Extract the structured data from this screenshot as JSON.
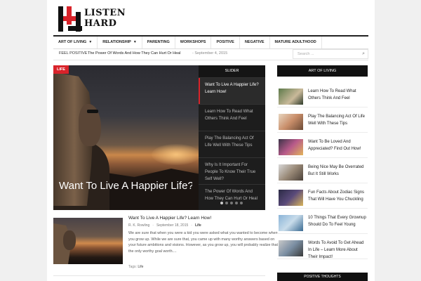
{
  "brand": {
    "line1": "LISTEN",
    "line2": "HARD",
    "accent": "#d9232a"
  },
  "nav": {
    "items": [
      {
        "label": "Art of Living",
        "has_dropdown": true
      },
      {
        "label": "Relationship",
        "has_dropdown": true
      },
      {
        "label": "Parenting",
        "has_dropdown": false
      },
      {
        "label": "Workshops",
        "has_dropdown": false
      },
      {
        "label": "Positive",
        "has_dropdown": false
      },
      {
        "label": "Negative",
        "has_dropdown": false
      },
      {
        "label": "Mature Adulthood",
        "has_dropdown": false
      }
    ],
    "chevron": "▼"
  },
  "ticker": {
    "label": "FEEL POSITIVE",
    "text": "The Power Of Words And How They Can Hurt Or Heal",
    "date": "- September 4, 2015"
  },
  "search": {
    "placeholder": "Search ...",
    "icon": "search-icon"
  },
  "slider": {
    "badge": "Life",
    "hero_title": "Want To Live A Happier Life? Learn How!",
    "header": "SLIDER",
    "items": [
      "Want To Live A Happier Life? Learn How!",
      "Learn How To Read What Others Think And Feel",
      "Play The Balancing Act Of Life Well With These Tips",
      "Why Is It Important For People To Know Their True Self Well?",
      "The Power Of Words And How They Can Hurt Or Heal"
    ],
    "active_index": 0,
    "dots": 5
  },
  "post": {
    "title": "Want To Live A Happier Life? Learn How!",
    "author": "R. K. Rowling",
    "date": "September 18, 2015",
    "category": "Life",
    "excerpt": "We are sure that when you were a kid you were asked what you wanted to become when you grow up. While we are sure that, you came up with many worthy answers based on your future ambitions and visions. However, as you grow up, you will probably realize that the only worthy goal worth....",
    "tags_label": "Tags:",
    "tags_value": "Life"
  },
  "sidebar": {
    "header": "ART OF LIVING",
    "items": [
      "Learn How To Read What Others Think And Feel",
      "Play The Balancing Act Of Life Well With These Tips",
      "Want To Be Loved And Appreciated? Find Out How!",
      "Being Nice May Be Overrated But It Still Works",
      "Fun Facts About Zodiac Signs That Will Have You Chuckling",
      "10 Things That Every Grownup Should Do To Feel Young",
      "Words To Avoid To Get Ahead In Life – Learn More About Their Impact!"
    ],
    "header2": "POSITIVE THOUGHTS"
  }
}
